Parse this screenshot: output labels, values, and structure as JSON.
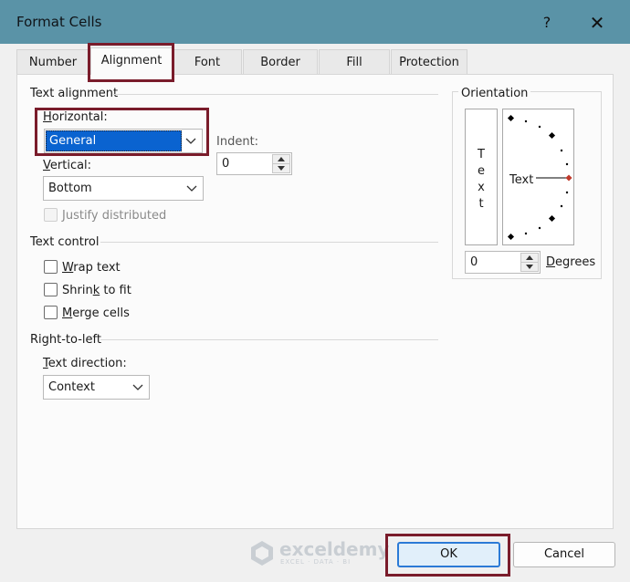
{
  "window": {
    "title": "Format Cells",
    "help": "?",
    "close": "✕"
  },
  "tabs": [
    {
      "label": "Number"
    },
    {
      "label": "Alignment"
    },
    {
      "label": "Font"
    },
    {
      "label": "Border"
    },
    {
      "label": "Fill"
    },
    {
      "label": "Protection"
    }
  ],
  "text_alignment": {
    "group_label": "Text alignment",
    "horizontal": {
      "label_ul": "H",
      "label_rest": "orizontal:",
      "value": "General"
    },
    "vertical": {
      "label_ul": "V",
      "label_rest": "ertical:",
      "value": "Bottom"
    },
    "indent": {
      "label": "Indent:",
      "value": "0"
    },
    "justify_distributed": {
      "label": "Justify distributed",
      "checked": false,
      "enabled": false
    }
  },
  "text_control": {
    "group_label": "Text control",
    "wrap_text": {
      "label_ul": "W",
      "label_rest": "rap text",
      "checked": false
    },
    "shrink_to_fit": {
      "label_pre": "Shrin",
      "label_ul": "k",
      "label_rest": " to fit",
      "checked": false
    },
    "merge_cells": {
      "label_ul": "M",
      "label_rest": "erge cells",
      "checked": false
    }
  },
  "right_to_left": {
    "group_label": "Right-to-left",
    "text_direction": {
      "label_ul": "T",
      "label_rest": "ext direction:",
      "value": "Context"
    }
  },
  "orientation": {
    "group_label": "Orientation",
    "vertical_letters": [
      "T",
      "e",
      "x",
      "t"
    ],
    "dial_text": "Text",
    "degrees": {
      "value": "0",
      "label_pre": "",
      "label_ul": "D",
      "label_rest": "egrees"
    }
  },
  "buttons": {
    "ok": "OK",
    "cancel": "Cancel"
  },
  "watermark": {
    "brand": "exceldemy",
    "tagline": "EXCEL · DATA · BI"
  },
  "colors": {
    "titlebar": "#5a93a7",
    "highlight": "#7a1c2b",
    "selection": "#0a63d0",
    "accent_dot": "#c0392b"
  }
}
